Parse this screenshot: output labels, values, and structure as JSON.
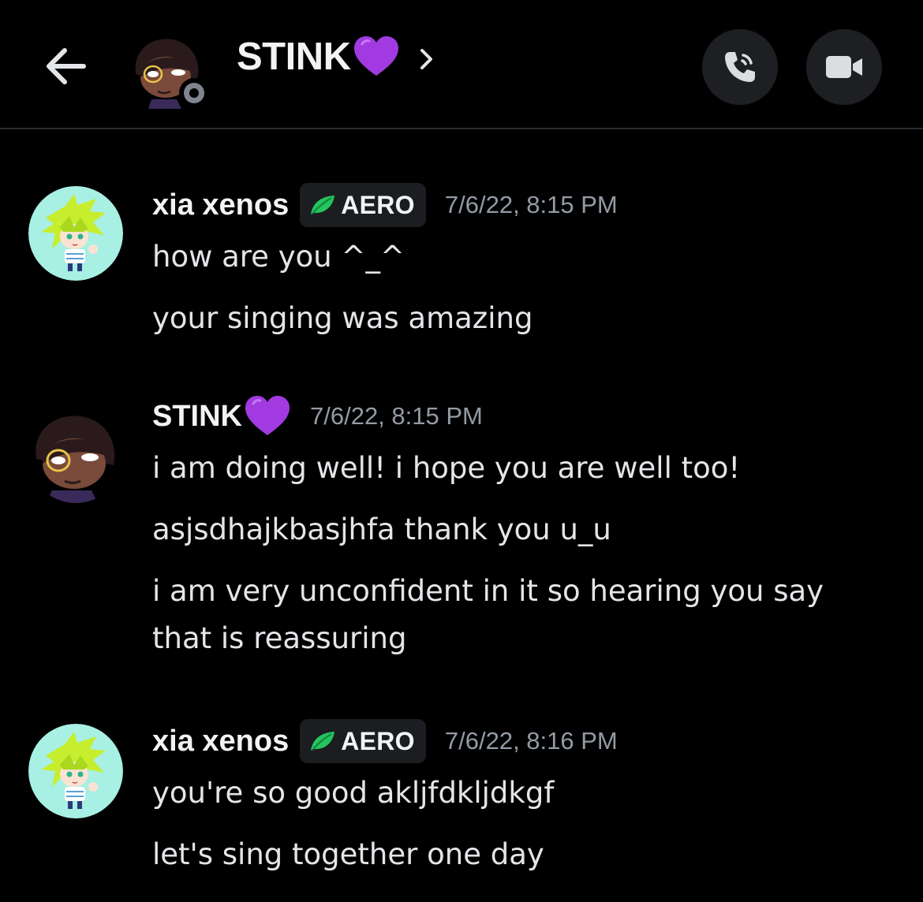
{
  "header": {
    "back_icon": "arrow-left-icon",
    "channel_name": "STINK",
    "channel_emoji": "purple-heart-emoji",
    "chevron_icon": "chevron-right-icon",
    "status_icon": "offline-status-icon",
    "call_icon": "phone-call-icon",
    "video_icon": "video-camera-icon"
  },
  "colors": {
    "background": "#000000",
    "divider": "#2b2d31",
    "button_bg": "#1e1f22",
    "timestamp": "#949ba4",
    "message_text": "#e3e5e8",
    "heart": "#a13ae0",
    "leaf": "#23c55e",
    "avatar_xia_bg": "#a8efe4"
  },
  "messages": [
    {
      "author": "xia xenos",
      "tag": "AERO",
      "tag_icon": "leaf-icon",
      "timestamp": "7/6/22, 8:15 PM",
      "lines": [
        "how are you ^_^",
        "your singing was amazing"
      ]
    },
    {
      "author": "STINK",
      "author_emoji": "purple-heart-emoji",
      "timestamp": "7/6/22, 8:15 PM",
      "lines": [
        "i am doing well! i hope you are well too!",
        "asjsdhajkbasjhfa thank you u_u",
        "i am very unconfident in it so hearing you say that is reassuring"
      ]
    },
    {
      "author": "xia xenos",
      "tag": "AERO",
      "tag_icon": "leaf-icon",
      "timestamp": "7/6/22, 8:16 PM",
      "lines": [
        "you're so good akljfdkljdkgf",
        "let's sing together one day"
      ]
    }
  ]
}
